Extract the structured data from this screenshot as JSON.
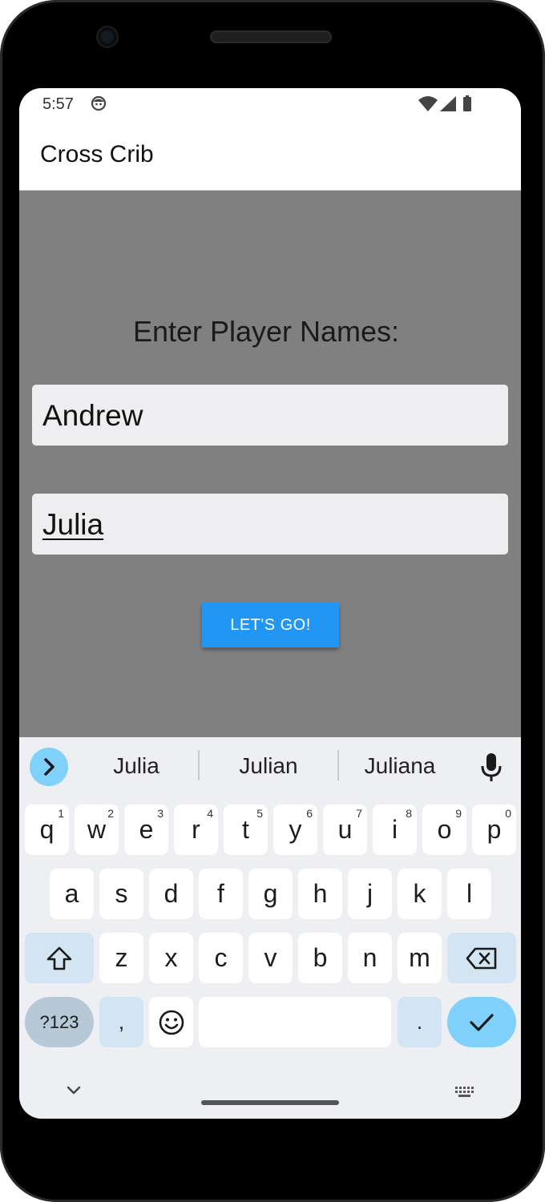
{
  "status_bar": {
    "time": "5:57",
    "icons": [
      "face-icon",
      "wifi-icon",
      "signal-icon",
      "battery-icon"
    ]
  },
  "app_bar": {
    "title": "Cross Crib"
  },
  "main": {
    "prompt": "Enter Player Names:",
    "player1": {
      "value": "Andrew"
    },
    "player2": {
      "value": "Julia"
    },
    "go_button": {
      "label": "LET'S GO!",
      "color": "#2196f3"
    }
  },
  "keyboard": {
    "suggestions": [
      "Julia",
      "Julian",
      "Juliana"
    ],
    "row1": [
      {
        "k": "q",
        "hint": "1"
      },
      {
        "k": "w",
        "hint": "2"
      },
      {
        "k": "e",
        "hint": "3"
      },
      {
        "k": "r",
        "hint": "4"
      },
      {
        "k": "t",
        "hint": "5"
      },
      {
        "k": "y",
        "hint": "6"
      },
      {
        "k": "u",
        "hint": "7"
      },
      {
        "k": "i",
        "hint": "8"
      },
      {
        "k": "o",
        "hint": "9"
      },
      {
        "k": "p",
        "hint": "0"
      }
    ],
    "row2": [
      "a",
      "s",
      "d",
      "f",
      "g",
      "h",
      "j",
      "k",
      "l"
    ],
    "row3": [
      "z",
      "x",
      "c",
      "v",
      "b",
      "n",
      "m"
    ],
    "row4": {
      "symbols": "?123",
      "comma": ",",
      "period": "."
    },
    "colors": {
      "accent": "#7fd0fb",
      "modifier": "#d3e4f3"
    }
  }
}
